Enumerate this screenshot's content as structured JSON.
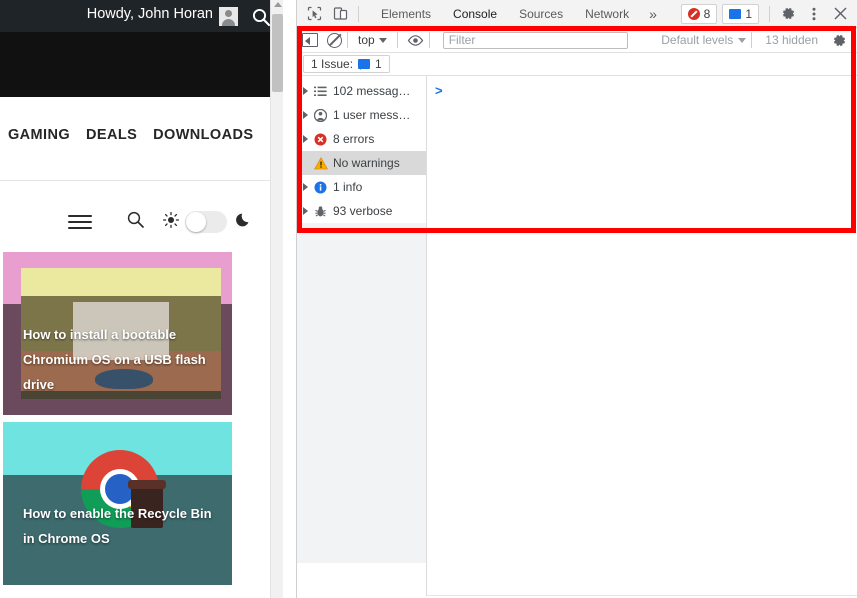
{
  "page": {
    "greeting": "Howdy, John Horan",
    "avatar_icon": "user-avatar-icon",
    "search_icon": "search-icon",
    "nav": [
      "GAMING",
      "DEALS",
      "DOWNLOADS"
    ],
    "tools": {
      "menu_icon": "hamburger-menu-icon",
      "search_icon": "search-icon",
      "light_icon": "sun-icon",
      "dark_icon": "moon-icon",
      "theme_toggle_state": "light"
    },
    "cards": [
      {
        "title": "How to install a bootable Chromium OS on a USB flash drive"
      },
      {
        "title": "How to enable the Recycle Bin in Chrome OS"
      }
    ]
  },
  "devtools": {
    "tabbar": {
      "inspect_icon": "inspect-element-icon",
      "device_icon": "device-toolbar-icon",
      "tabs": [
        {
          "label": "Elements",
          "active": false
        },
        {
          "label": "Console",
          "active": true
        },
        {
          "label": "Sources",
          "active": false
        },
        {
          "label": "Network",
          "active": false
        }
      ],
      "more_tabs": "»",
      "error_count": "8",
      "message_count": "1",
      "settings_icon": "gear-icon",
      "kebab_icon": "more-options-icon",
      "close_icon": "close-icon"
    },
    "console_toolbar": {
      "sidebar_toggle_icon": "console-sidebar-toggle-icon",
      "clear_icon": "clear-console-icon",
      "context": "top",
      "eye_icon": "live-expression-icon",
      "filter_placeholder": "Filter",
      "filter_value": "",
      "levels_label": "Default levels",
      "hidden_label": "13 hidden",
      "settings_icon": "gear-icon"
    },
    "issue_bar": {
      "label": "1 Issue:",
      "count": "1",
      "icon": "issue-message-icon"
    },
    "sidebar": [
      {
        "label": "102 messag…",
        "icon": "list-icon",
        "selected": false,
        "expandable": true
      },
      {
        "label": "1 user mess…",
        "icon": "user-icon",
        "selected": false,
        "expandable": true
      },
      {
        "label": "8 errors",
        "icon": "error-icon",
        "selected": false,
        "expandable": true
      },
      {
        "label": "No warnings",
        "icon": "warning-icon",
        "selected": true,
        "expandable": false
      },
      {
        "label": "1 info",
        "icon": "info-icon",
        "selected": false,
        "expandable": true
      },
      {
        "label": "93 verbose",
        "icon": "bug-icon",
        "selected": false,
        "expandable": true
      }
    ],
    "console_prompt": ">"
  },
  "colors": {
    "highlight_box": "#ff0000",
    "error_red": "#d93025",
    "info_blue": "#1a73e8",
    "warning_yellow": "#f9ab00",
    "page_topbar": "#1f2428",
    "page_black": "#111111",
    "card1_band": "#e89fd0",
    "card2_band": "#6ee3e0"
  }
}
